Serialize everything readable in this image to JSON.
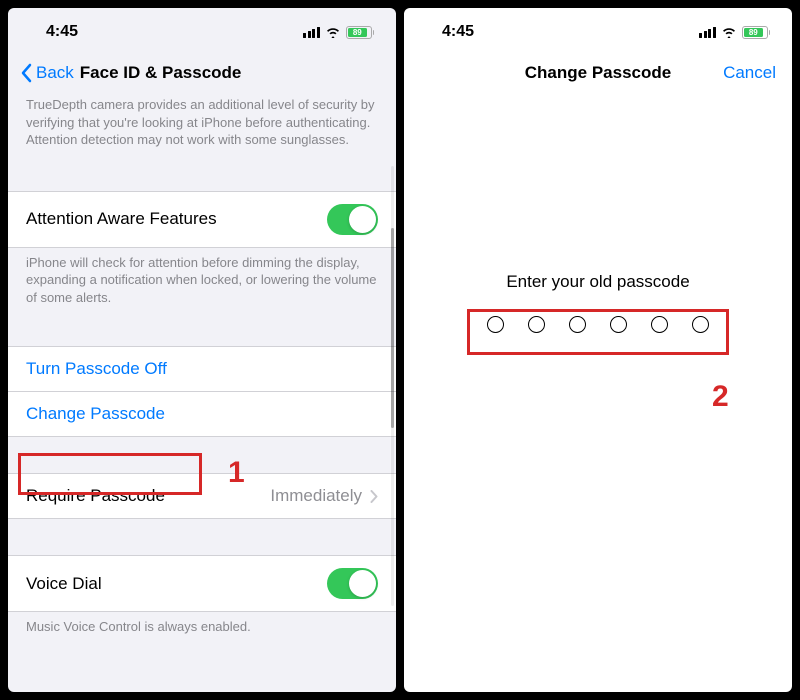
{
  "status": {
    "time": "4:45",
    "battery_pct": "89"
  },
  "left": {
    "back_label": "Back",
    "title": "Face ID & Passcode",
    "truedepth_footer": "TrueDepth camera provides an additional level of security by verifying that you're looking at iPhone before authenticating. Attention detection may not work with some sunglasses.",
    "attention_aware_label": "Attention Aware Features",
    "attention_footer": "iPhone will check for attention before dimming the display, expanding a notification when locked, or lowering the volume of some alerts.",
    "turn_off_label": "Turn Passcode Off",
    "change_label": "Change Passcode",
    "require_label": "Require Passcode",
    "require_value": "Immediately",
    "voice_dial_label": "Voice Dial",
    "voice_footer": "Music Voice Control is always enabled.",
    "step_1": "1"
  },
  "right": {
    "title": "Change Passcode",
    "cancel_label": "Cancel",
    "enter_label": "Enter your old passcode",
    "step_2": "2"
  }
}
